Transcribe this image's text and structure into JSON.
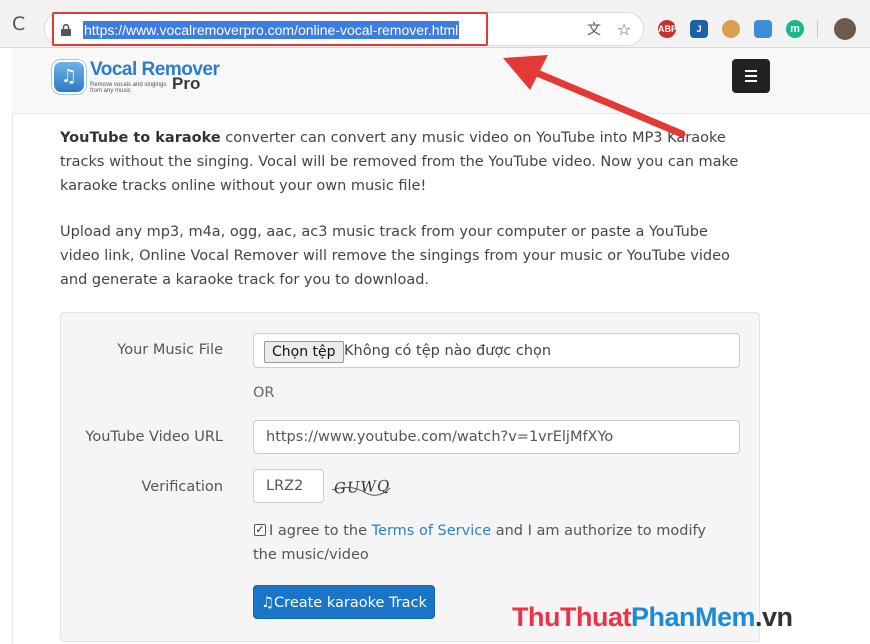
{
  "browser": {
    "url": "https://www.vocalremoverpro.com/online-vocal-remover.html",
    "reload_glyph": "C",
    "icons": [
      "reload-icon",
      "lock-icon",
      "translate-icon",
      "star-icon"
    ],
    "extensions": [
      {
        "name": "abp-extension-icon",
        "label": "ABP",
        "color": "#c9302c"
      },
      {
        "name": "j-extension-icon",
        "label": "J",
        "color": "#1f5fa8"
      },
      {
        "name": "cookie-extension-icon",
        "label": "",
        "color": "#d7a24b"
      },
      {
        "name": "download-extension-icon",
        "label": "",
        "color": "#3b8fd6"
      },
      {
        "name": "m-extension-icon",
        "label": "m",
        "color": "#19b58c"
      }
    ]
  },
  "header": {
    "logo_title": "Vocal Remover",
    "logo_tagline": "Remove vocals and singings from any music",
    "logo_suffix": "Pro",
    "menu_icon": "hamburger-menu-icon"
  },
  "intro": {
    "bold_lead": "YouTube to karaoke",
    "paragraph1_rest": " converter can convert any music video on YouTube into MP3 Karaoke tracks without the singing. Vocal will be removed from the YouTube video. Now you can make karaoke tracks online without your own music file!",
    "paragraph2": "Upload any mp3, m4a, ogg, aac, ac3 music track from your computer or paste a YouTube video link, Online Vocal Remover will remove the singings from your music or YouTube video and generate a karaoke track for you to download."
  },
  "form": {
    "music_file_label": "Your Music File",
    "choose_file_button": "Chọn tệp",
    "file_status": "Không có tệp nào được chọn",
    "or_text": "OR",
    "youtube_label": "YouTube Video URL",
    "youtube_value": "https://www.youtube.com/watch?v=1vrEljMfXYo",
    "verification_label": "Verification",
    "verification_value": "LRZ2",
    "captcha_text": "GUWQ",
    "agree_checked": true,
    "agree_prefix": "I agree to the ",
    "terms_link": "Terms of Service",
    "agree_suffix": " and I am authorize to modify the music/video",
    "create_button": "Create karaoke Track",
    "create_button_icon": "music-note-icon"
  },
  "watermark": {
    "part1": "Thu",
    "part2": "Thuat",
    "part3": "PhanMem",
    "part4": ".vn"
  },
  "annotation": {
    "highlight_color": "#e53935",
    "arrow_color": "#e53935"
  }
}
